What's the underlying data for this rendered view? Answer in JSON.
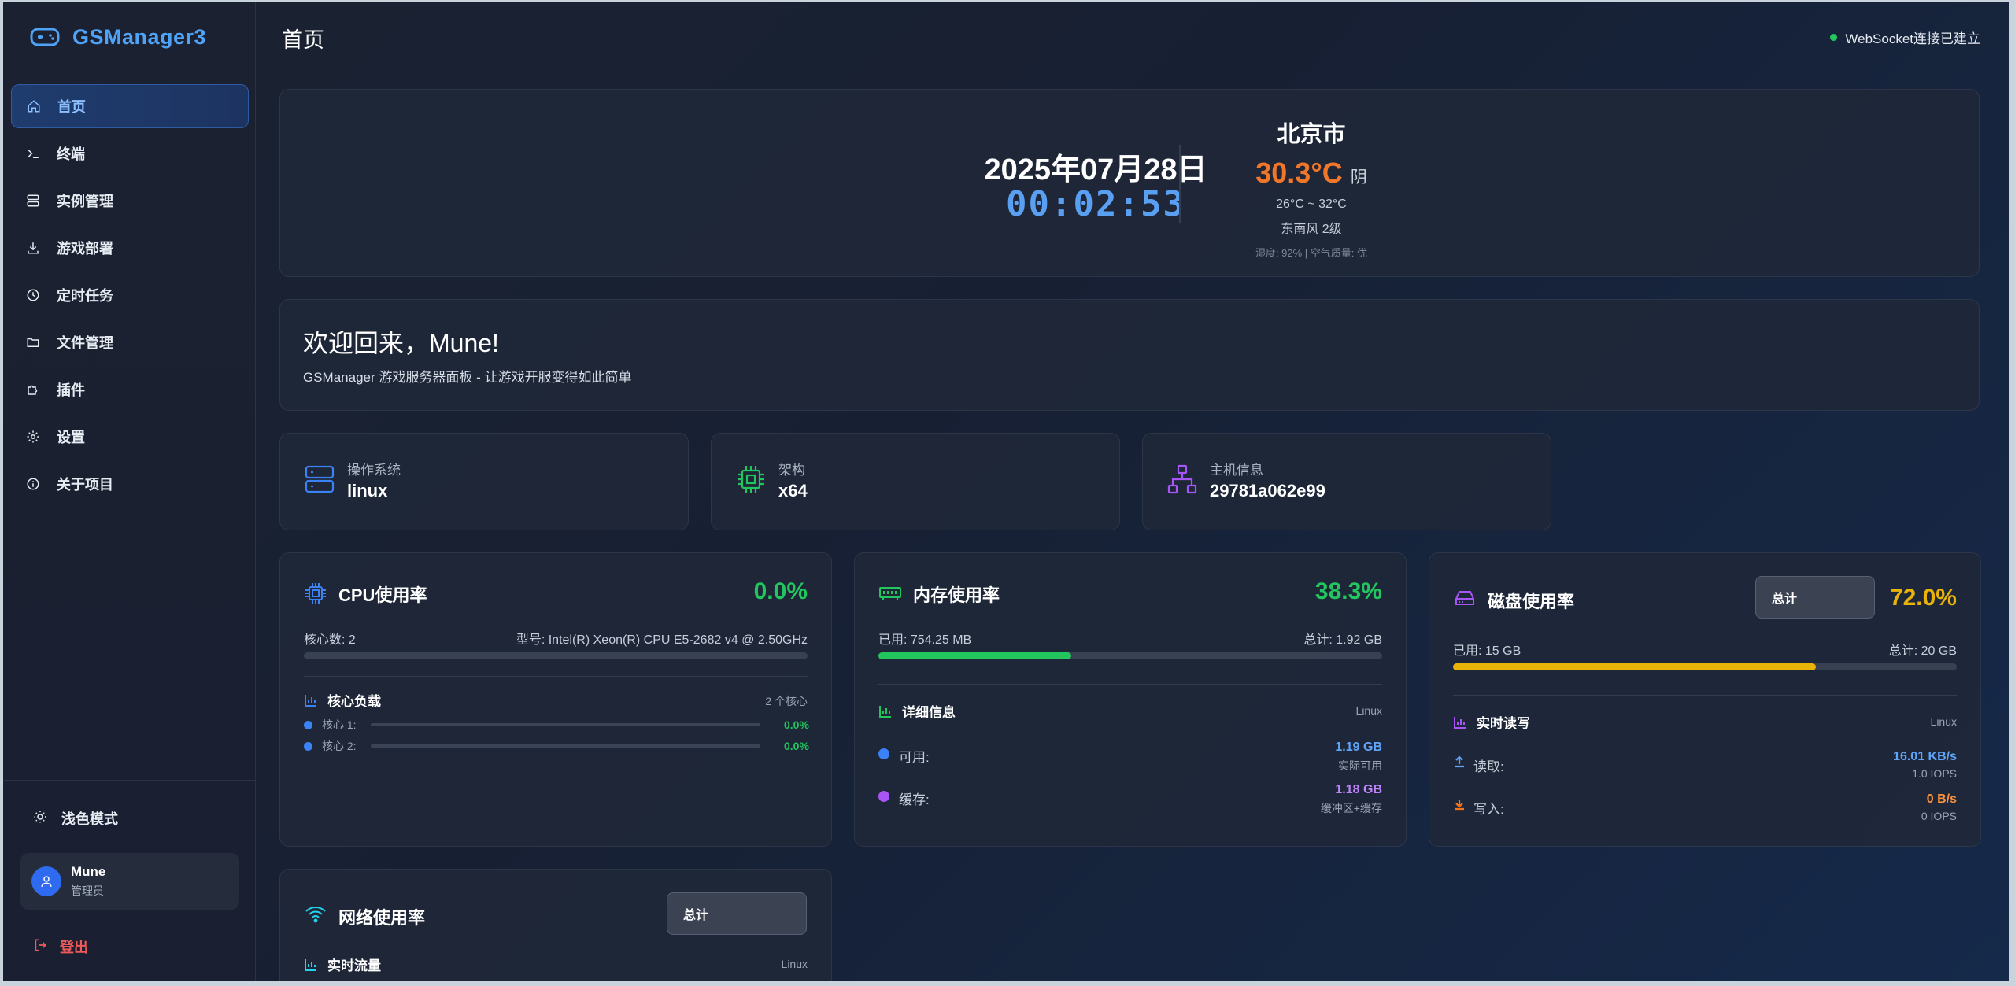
{
  "app": {
    "name": "GSManager3"
  },
  "sidebar": {
    "items": [
      {
        "label": "首页",
        "icon": "home-icon"
      },
      {
        "label": "终端",
        "icon": "terminal-icon"
      },
      {
        "label": "实例管理",
        "icon": "server-icon"
      },
      {
        "label": "游戏部署",
        "icon": "download-icon"
      },
      {
        "label": "定时任务",
        "icon": "clock-icon"
      },
      {
        "label": "文件管理",
        "icon": "folder-icon"
      },
      {
        "label": "插件",
        "icon": "puzzle-icon"
      },
      {
        "label": "设置",
        "icon": "gear-icon"
      },
      {
        "label": "关于项目",
        "icon": "info-icon"
      }
    ],
    "theme_toggle": "浅色模式",
    "user": {
      "name": "Mune",
      "role": "管理员"
    },
    "logout": "登出"
  },
  "header": {
    "title": "首页",
    "ws_status": "WebSocket连接已建立"
  },
  "clock": {
    "date": "2025年07月28日",
    "time": "00:02:53"
  },
  "weather": {
    "city": "北京市",
    "temp": "30.3°C",
    "condition": "阴",
    "range": "26°C ~ 32°C",
    "wind": "东南风 2级",
    "extra": "湿度: 92% | 空气质量: 优"
  },
  "welcome": {
    "title": "欢迎回来，Mune!",
    "subtitle": "GSManager 游戏服务器面板 - 让游戏开服变得如此简单"
  },
  "info": {
    "os": {
      "label": "操作系统",
      "value": "linux"
    },
    "arch": {
      "label": "架构",
      "value": "x64"
    },
    "host": {
      "label": "主机信息",
      "value": "29781a062e99"
    }
  },
  "cpu": {
    "title": "CPU使用率",
    "percent": "0.0%",
    "usage_fraction": 0.0,
    "cores_text": "核心数: 2",
    "model_text": "型号: Intel(R) Xeon(R) CPU E5-2682 v4 @ 2.50GHz",
    "load_title": "核心负载",
    "load_count": "2 个核心",
    "cores": [
      {
        "label": "核心 1:",
        "value": "0.0%"
      },
      {
        "label": "核心 2:",
        "value": "0.0%"
      }
    ]
  },
  "memory": {
    "title": "内存使用率",
    "percent": "38.3%",
    "usage_fraction": 0.383,
    "used": "已用: 754.25 MB",
    "total": "总计: 1.92 GB",
    "detail_title": "详细信息",
    "detail_os": "Linux",
    "available_label": "可用:",
    "available_value": "1.19 GB",
    "available_note": "实际可用",
    "cache_label": "缓存:",
    "cache_value": "1.18 GB",
    "cache_note": "缓冲区+缓存"
  },
  "disk": {
    "title": "磁盘使用率",
    "select": "总计",
    "percent": "72.0%",
    "usage_fraction": 0.72,
    "used": "已用: 15 GB",
    "total": "总计: 20 GB",
    "io_title": "实时读写",
    "io_os": "Linux",
    "read_label": "读取:",
    "read_value": "16.01 KB/s",
    "read_iops": "1.0 IOPS",
    "write_label": "写入:",
    "write_value": "0 B/s",
    "write_iops": "0 IOPS"
  },
  "network": {
    "title": "网络使用率",
    "select": "总计",
    "traffic_title": "实时流量",
    "traffic_os": "Linux"
  },
  "colors": {
    "accent": "#4fa3f7",
    "green": "#22c55e",
    "orange": "#f0762a",
    "yellow": "#eab308",
    "purple": "#a855f7"
  }
}
